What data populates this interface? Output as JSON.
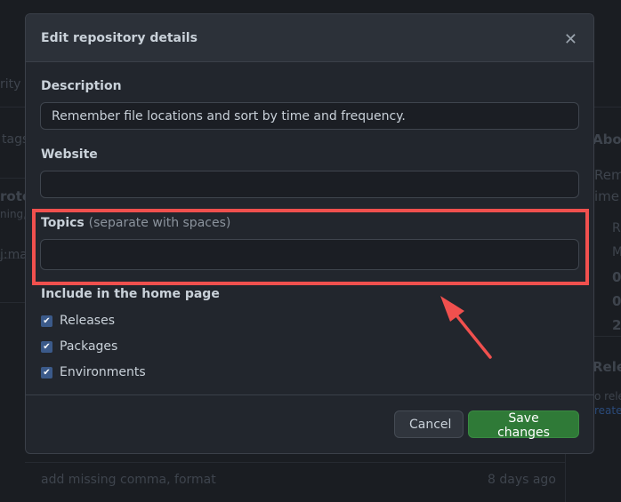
{
  "background": {
    "frag_security": "rity",
    "frag_tags": "tags",
    "frag_protect": "rote",
    "frag_warning": "ning,",
    "frag_branch": "j:ma",
    "about_heading": "Abou",
    "about_desc_1": "Reme",
    "about_desc_2": "ime",
    "about_readme": "R",
    "about_license": "M",
    "about_stars": "0",
    "about_watchers": "0",
    "about_forks": "2",
    "releases_heading": "Relea",
    "releases_none": "o rele",
    "releases_create": "reate",
    "commit_message": "add missing comma, format",
    "commit_time": "8 days ago"
  },
  "modal": {
    "title": "Edit repository details",
    "close_icon": "close-icon",
    "description_label": "Description",
    "description_value": "Remember file locations and sort by time and frequency.",
    "website_label": "Website",
    "website_value": "",
    "topics_label": "Topics",
    "topics_hint": "(separate with spaces)",
    "topics_value": "",
    "include_label": "Include in the home page",
    "checkboxes": [
      {
        "label": "Releases",
        "checked": true
      },
      {
        "label": "Packages",
        "checked": true
      },
      {
        "label": "Environments",
        "checked": true
      }
    ],
    "cancel_label": "Cancel",
    "save_label": "Save changes"
  },
  "annotation": {
    "highlight_color": "#f0504e",
    "arrow_color": "#f0504e"
  },
  "colors": {
    "save_button": "#2f7a37",
    "checkbox": "#3b5a8a"
  }
}
